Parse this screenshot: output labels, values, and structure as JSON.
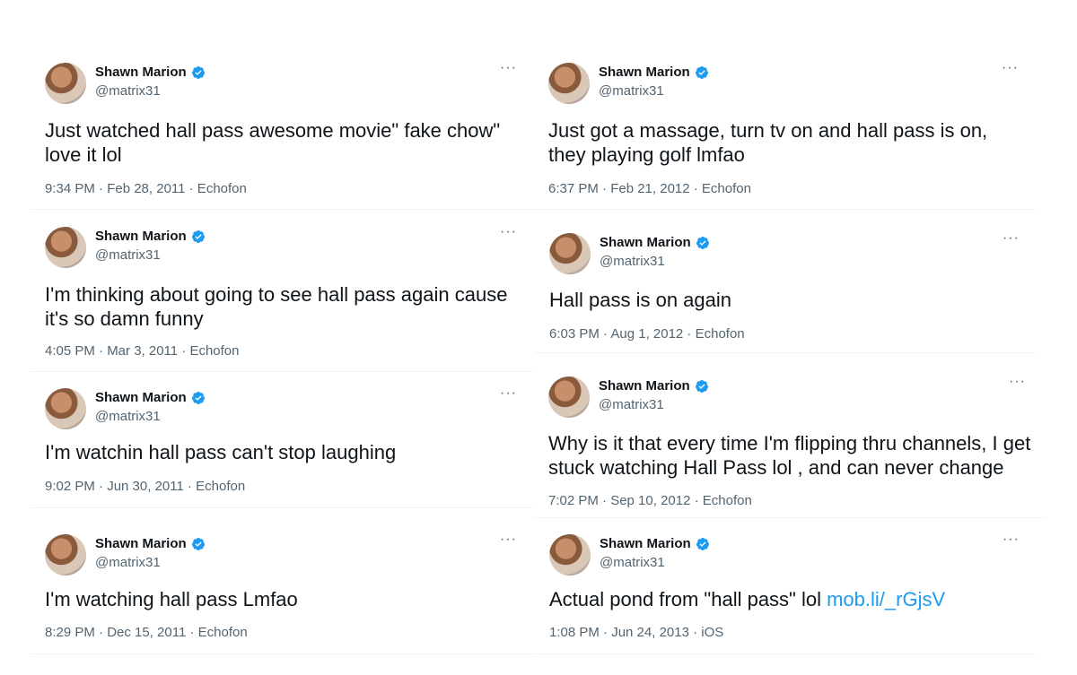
{
  "author": {
    "name": "Shawn Marion",
    "handle": "@matrix31",
    "verified_color": "#1d9bf0"
  },
  "more_icon": "···",
  "tweets": [
    {
      "text": "Just watched hall pass awesome movie\" fake chow\" love it lol",
      "link": "",
      "meta": "9:34 PM · Feb 28, 2011 · Echofon"
    },
    {
      "text": "I'm thinking about going to see hall pass again cause it's so damn funny",
      "link": "",
      "meta": "4:05 PM · Mar 3, 2011 · Echofon"
    },
    {
      "text": "I'm watchin hall pass can't stop laughing",
      "link": "",
      "meta": "9:02 PM · Jun 30, 2011 · Echofon"
    },
    {
      "text": "I'm watching hall pass Lmfao",
      "link": "",
      "meta": "8:29 PM · Dec 15, 2011 · Echofon"
    },
    {
      "text": "Just got a massage, turn tv on and hall pass is on, they playing golf lmfao",
      "link": "",
      "meta": "6:37 PM · Feb 21, 2012 · Echofon"
    },
    {
      "text": "Hall pass is on again",
      "link": "",
      "meta": "6:03 PM · Aug 1, 2012 · Echofon"
    },
    {
      "text": "Why is it that every time I'm flipping thru channels, I get stuck watching Hall Pass lol , and can never change",
      "link": "",
      "meta": "7:02 PM · Sep 10, 2012 · Echofon"
    },
    {
      "text": "Actual pond from \"hall pass\" lol ",
      "link": "mob.li/_rGjsV",
      "meta": "1:08 PM · Jun 24, 2013 · iOS"
    }
  ]
}
